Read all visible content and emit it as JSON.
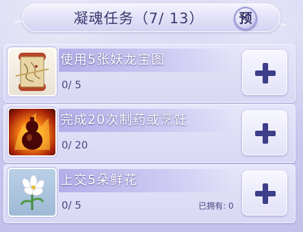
{
  "header": {
    "title": "凝魂任务（7/ 13）",
    "preview_label": "预"
  },
  "tasks": [
    {
      "title": "使用5张妖龙宝图",
      "progress": "0/ 5",
      "owned": "",
      "icon": "treasure-map-icon"
    },
    {
      "title": "完成20次制药或烹饪",
      "progress": "0/ 20",
      "owned": "",
      "icon": "fire-gourd-icon"
    },
    {
      "title": "上交5朵鲜花",
      "progress": "0/ 5",
      "owned": "已拥有: 0",
      "icon": "lily-flower-icon"
    }
  ],
  "colors": {
    "accent": "#3d3f8a",
    "panel": "#c9c8ee",
    "title_text": "#ffffff"
  }
}
